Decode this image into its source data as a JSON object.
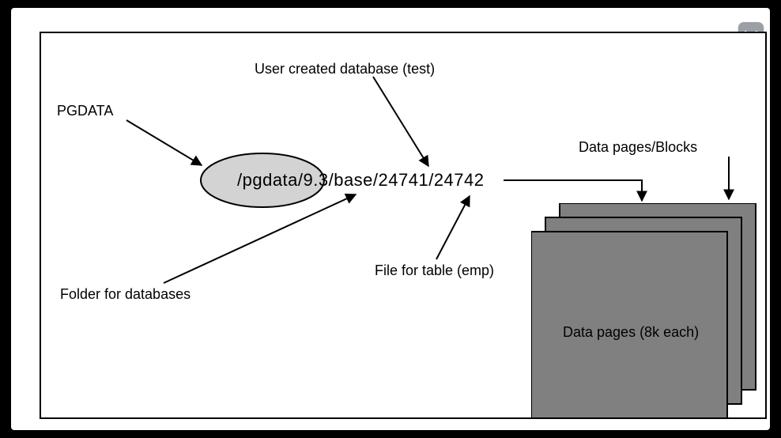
{
  "labels": {
    "pgdata": "PGDATA",
    "user_created_db": "User created database (test)",
    "data_pages_blocks": "Data pages/Blocks",
    "folder_for_dbs": "Folder for databases",
    "file_for_table": "File for table (emp)",
    "stack_caption": "Data pages (8k each)"
  },
  "path": {
    "full": "/pgdata/9.3/base/24741/24742",
    "segments": {
      "root": "/pgdata/9.3",
      "base_dir": "/base",
      "db_oid": "24741",
      "table_oid": "24742"
    }
  },
  "page_size": "8k",
  "colors": {
    "ellipse_fill": "#d3d3d3",
    "stack_fill": "#808080",
    "button_bg": "#9aa0a6",
    "button_fg": "#ffffff"
  }
}
